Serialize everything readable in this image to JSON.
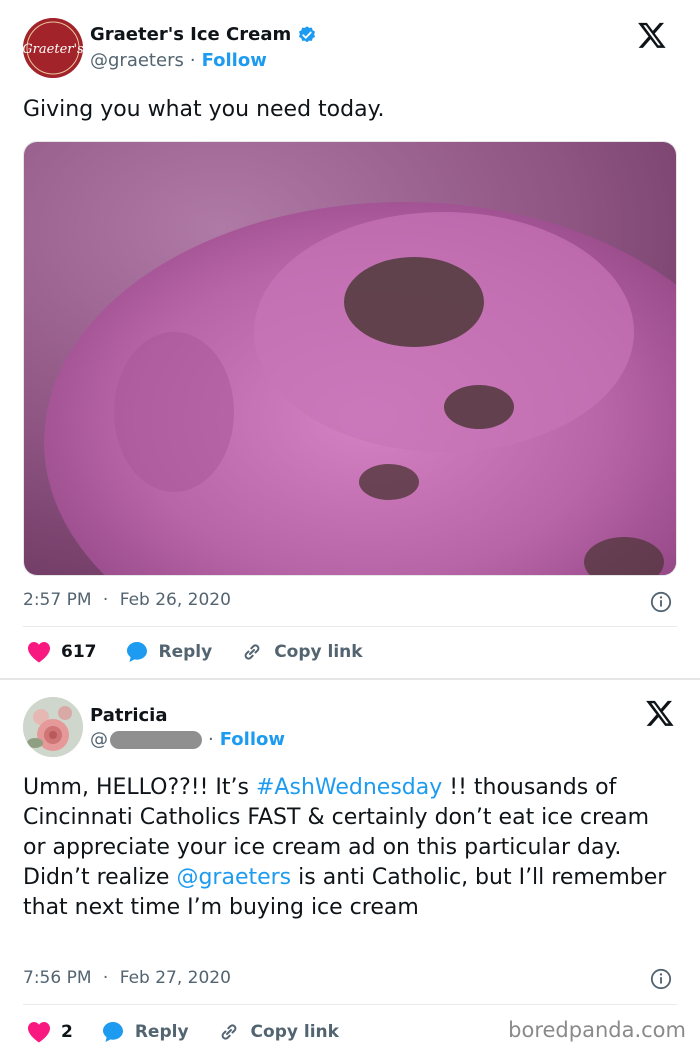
{
  "tweet1": {
    "author_name": "Graeter's Ice Cream",
    "handle": "@graeters",
    "follow_label": "Follow",
    "verified": true,
    "text": "Giving you what you need today.",
    "time": "2:57 PM",
    "date": "Feb 26, 2020",
    "likes": "617",
    "reply_label": "Reply",
    "copy_label": "Copy link",
    "logo_text": "Graeter's"
  },
  "tweet2": {
    "author_name": "Patricia",
    "handle_prefix": "@",
    "follow_label": "Follow",
    "text_parts": {
      "p1": "Umm, HELLO??!!  It’s ",
      "hashtag": "#AshWednesday",
      "p2": " !! thousands of Cincinnati Catholics FAST & certainly don’t eat ice cream or appreciate your ice cream ad on this particular day. Didn’t realize ",
      "mention": "@graeters",
      "p3": " is anti Catholic, but I’ll remember that next time I’m buying ice cream"
    },
    "time": "7:56 PM",
    "date": "Feb 27, 2020",
    "likes": "2",
    "reply_label": "Reply",
    "copy_label": "Copy link"
  },
  "watermark": "boredpanda.com",
  "colors": {
    "accent": "#1d9bf0",
    "like": "#f91880",
    "text": "#0f1419",
    "muted": "#536471"
  },
  "icons": [
    "verified-badge-icon",
    "x-logo-icon",
    "info-icon",
    "heart-icon",
    "reply-bubble-icon",
    "link-icon"
  ]
}
